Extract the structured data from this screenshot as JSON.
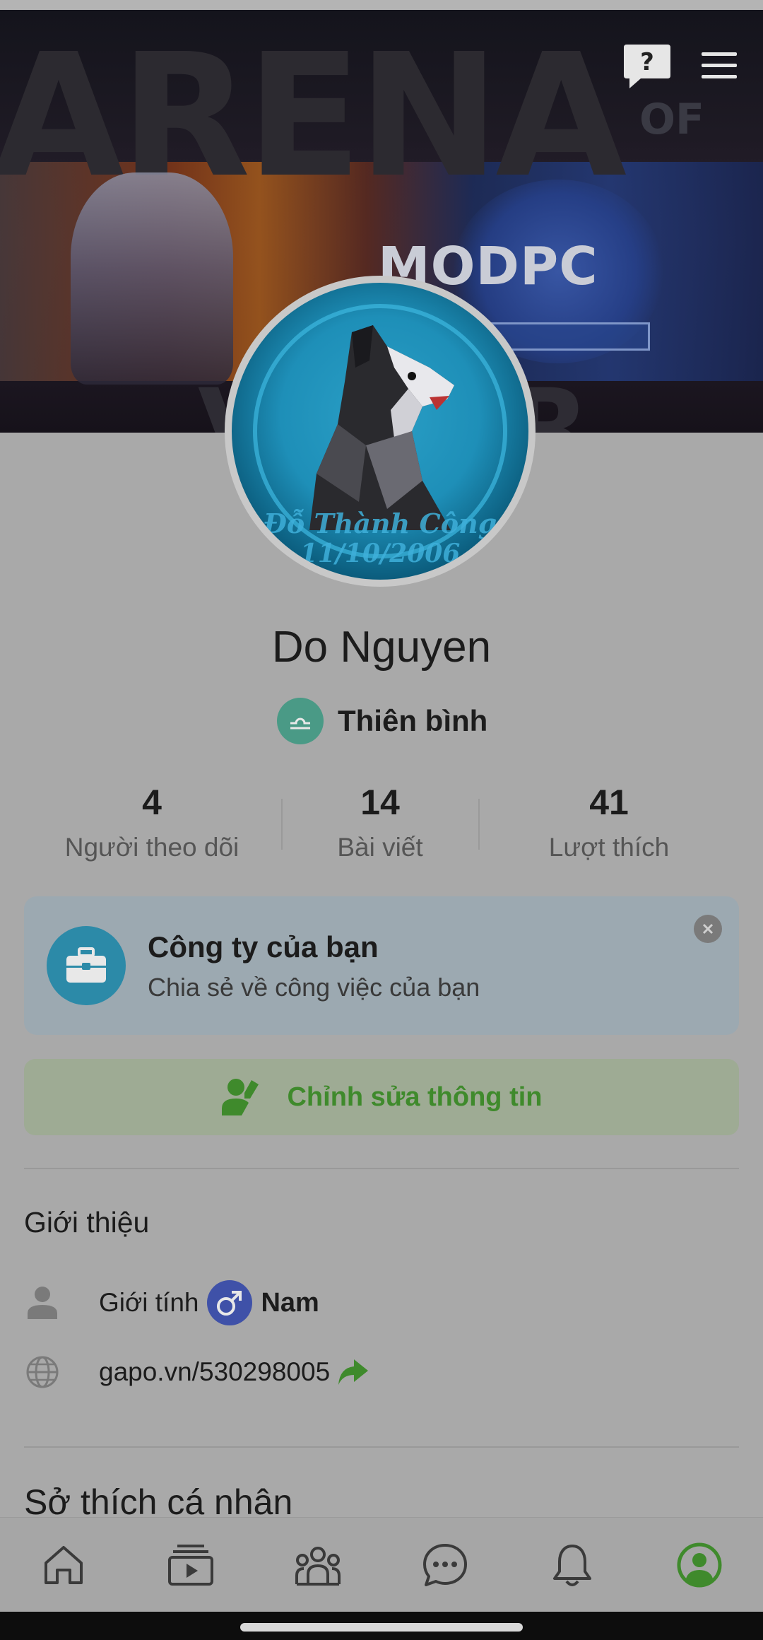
{
  "cover": {
    "big_word": "ARENA",
    "of_word": "OF",
    "brand_text": "MODPC",
    "bottom_word": "VALOR"
  },
  "header": {
    "help_icon": "question-bubble-icon",
    "menu_icon": "hamburger-menu-icon"
  },
  "avatar": {
    "caption_line1": "Đỗ Thành Công",
    "caption_line2": "11/10/2006"
  },
  "profile": {
    "name": "Do Nguyen",
    "zodiac_label": "Thiên bình",
    "zodiac_icon": "libra-icon"
  },
  "stats": [
    {
      "value": "4",
      "label": "Người theo dõi"
    },
    {
      "value": "14",
      "label": "Bài viết"
    },
    {
      "value": "41",
      "label": "Lượt thích"
    }
  ],
  "company_card": {
    "title": "Công ty của bạn",
    "subtitle": "Chia sẻ về công việc của bạn",
    "icon": "briefcase-icon"
  },
  "edit_button": {
    "label": "Chỉnh sửa thông tin",
    "icon": "user-edit-icon"
  },
  "intro": {
    "title": "Giới thiệu",
    "gender_label": "Giới tính",
    "gender_value": "Nam",
    "gender_icon": "male-symbol-icon",
    "link": "gapo.vn/530298005",
    "link_icon": "share-arrow-icon"
  },
  "hobbies": {
    "title": "Sở thích cá nhân"
  },
  "bottom_nav": [
    {
      "name": "home-icon"
    },
    {
      "name": "video-icon"
    },
    {
      "name": "groups-icon"
    },
    {
      "name": "chat-icon"
    },
    {
      "name": "bell-icon"
    },
    {
      "name": "profile-icon",
      "active": true
    }
  ],
  "colors": {
    "accent_green": "#3f8a2c",
    "company_blue": "#2c8aa8",
    "gender_blue": "#3f51a8",
    "zodiac_teal": "#4a9a86"
  }
}
